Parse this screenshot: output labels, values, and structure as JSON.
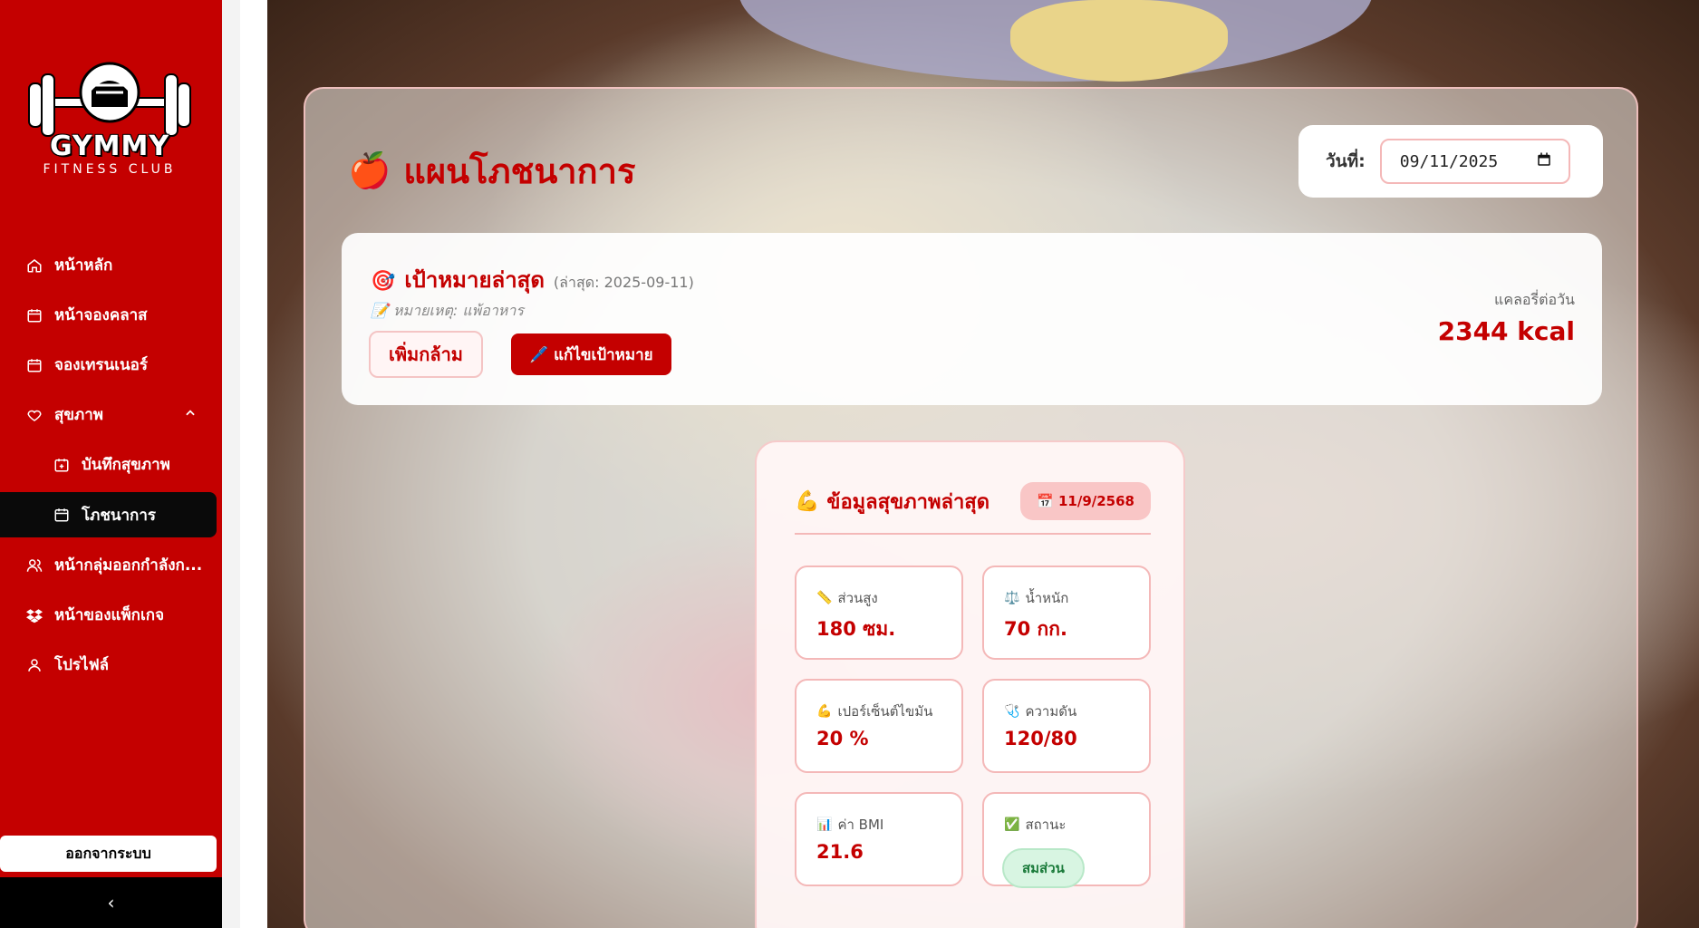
{
  "brand": {
    "name": "GYMMY",
    "subtitle": "FITNESS CLUB"
  },
  "sidebar": {
    "items": [
      {
        "label": "หน้าหลัก",
        "icon": "home-icon"
      },
      {
        "label": "หน้าจองคลาส",
        "icon": "calendar-icon"
      },
      {
        "label": "จองเทรนเนอร์",
        "icon": "calendar-icon"
      },
      {
        "label": "สุขภาพ",
        "icon": "heart-icon",
        "expanded": true
      },
      {
        "label": "บันทึกสุขภาพ",
        "icon": "calendar-plus-icon"
      },
      {
        "label": "โภชนาการ",
        "icon": "calendar-icon",
        "active": true
      },
      {
        "label": "หน้ากลุ่มออกกำลังก...",
        "icon": "users-icon"
      },
      {
        "label": "หน้าของแพ็กเกจ",
        "icon": "dropbox-icon"
      },
      {
        "label": "โปรไฟล์",
        "icon": "user-icon"
      }
    ],
    "logout_label": "ออกจากระบบ",
    "collapse_glyph": "‹"
  },
  "page": {
    "title": "แผนโภชนาการ",
    "title_icon": "🍎",
    "date_label": "วันที่:",
    "date_value": "09/11/2025"
  },
  "goal": {
    "icon": "🎯",
    "title": "เป้าหมายล่าสุด",
    "date": "(ล่าสุด: 2025-09-11)",
    "note": "📝 หมายเหตุ: แพ้อาหาร",
    "goal_button": "เพิ่มกล้าม",
    "edit_button": "🖊️ แก้ไขเป้าหมาย",
    "kcal_label": "แคลอรี่ต่อวัน",
    "kcal_value": "2344 kcal"
  },
  "health": {
    "icon": "💪",
    "title": "ข้อมูลสุขภาพล่าสุด",
    "date_badge": "📅 11/9/2568",
    "stats": [
      {
        "emoji": "📏",
        "label": "ส่วนสูง",
        "value": "180 ซม."
      },
      {
        "emoji": "⚖️",
        "label": "น้ำหนัก",
        "value": "70 กก."
      },
      {
        "emoji": "💪",
        "label": "เปอร์เซ็นต์ไขมัน",
        "value": "20 %"
      },
      {
        "emoji": "🩺",
        "label": "ความดัน",
        "value": "120/80"
      },
      {
        "emoji": "📊",
        "label": "ค่า BMI",
        "value": "21.6"
      },
      {
        "emoji": "✅",
        "label": "สถานะ",
        "value": "สมส่วน"
      }
    ]
  },
  "colors": {
    "brand": "#c40000",
    "sidebar": "#c40000",
    "active": "#0a0a0a",
    "status_ok": "#1a7a3a"
  }
}
